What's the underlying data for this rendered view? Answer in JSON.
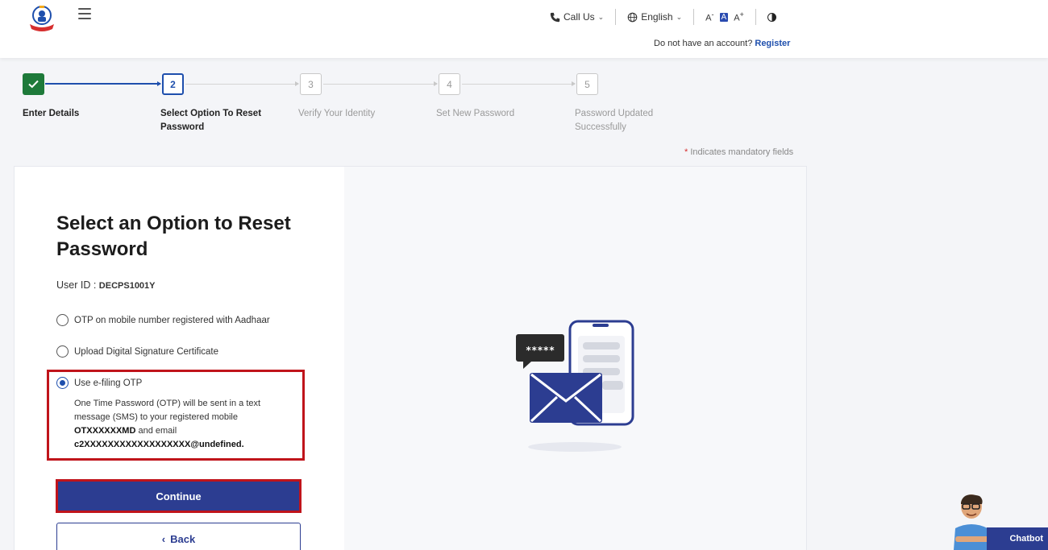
{
  "header": {
    "call_us": "Call Us",
    "language": "English",
    "font_small": "A",
    "font_normal": "A",
    "font_large": "A",
    "no_account": "Do not have an account?",
    "register": "Register"
  },
  "stepper": {
    "steps": [
      {
        "number": "1",
        "label": "Enter Details",
        "status": "completed"
      },
      {
        "number": "2",
        "label": "Select Option To Reset Password",
        "status": "active"
      },
      {
        "number": "3",
        "label": "Verify Your Identity",
        "status": "pending"
      },
      {
        "number": "4",
        "label": "Set New Password",
        "status": "pending"
      },
      {
        "number": "5",
        "label": "Password Updated Successfully",
        "status": "pending"
      }
    ]
  },
  "mandatory_note": "Indicates mandatory fields",
  "form": {
    "title": "Select an Option to Reset Password",
    "user_id_label": "User ID :",
    "user_id_value": "DECPS1001Y",
    "options": [
      {
        "label": "OTP on mobile number registered with Aadhaar",
        "selected": false
      },
      {
        "label": "Upload Digital Signature Certificate",
        "selected": false
      },
      {
        "label": "Use e-filing OTP",
        "selected": true
      }
    ],
    "efiling_desc_1": "One Time Password (OTP) will be sent in a text message (SMS) to your registered mobile",
    "efiling_mobile": "OTXXXXXXMD",
    "efiling_desc_2": "and email",
    "efiling_email": "c2XXXXXXXXXXXXXXXXXX@undefined.",
    "continue_label": "Continue",
    "back_label": "Back"
  },
  "illustration": {
    "password_mask": "*****"
  },
  "chatbot": {
    "label": "Chatbot"
  },
  "colors": {
    "primary": "#2c3d91",
    "link": "#1e4fad",
    "success": "#1e7a3a",
    "highlight": "#c0141b"
  }
}
